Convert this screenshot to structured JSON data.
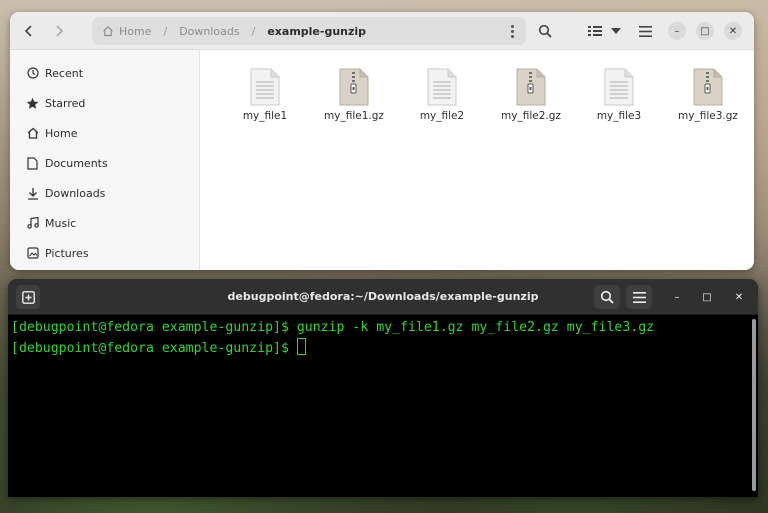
{
  "files_window": {
    "breadcrumbs": [
      {
        "label": "Home",
        "icon": "home-icon"
      },
      {
        "label": "Downloads"
      },
      {
        "label": "example-gunzip",
        "current": true
      }
    ],
    "sidebar": [
      {
        "label": "Recent",
        "icon": "clock-icon"
      },
      {
        "label": "Starred",
        "icon": "star-icon"
      },
      {
        "label": "Home",
        "icon": "home-icon"
      },
      {
        "label": "Documents",
        "icon": "document-icon"
      },
      {
        "label": "Downloads",
        "icon": "download-icon"
      },
      {
        "label": "Music",
        "icon": "music-icon"
      },
      {
        "label": "Pictures",
        "icon": "picture-icon"
      }
    ],
    "files": [
      {
        "name": "my_file1",
        "type": "text"
      },
      {
        "name": "my_file1.gz",
        "type": "archive"
      },
      {
        "name": "my_file2",
        "type": "text"
      },
      {
        "name": "my_file2.gz",
        "type": "archive"
      },
      {
        "name": "my_file3",
        "type": "text"
      },
      {
        "name": "my_file3.gz",
        "type": "archive"
      }
    ]
  },
  "terminal": {
    "title": "debugpoint@fedora:~/Downloads/example-gunzip",
    "lines": [
      "[debugpoint@fedora example-gunzip]$ gunzip -k my_file1.gz my_file2.gz my_file3.gz",
      "[debugpoint@fedora example-gunzip]$ "
    ],
    "text_color": "#2fd82f"
  }
}
